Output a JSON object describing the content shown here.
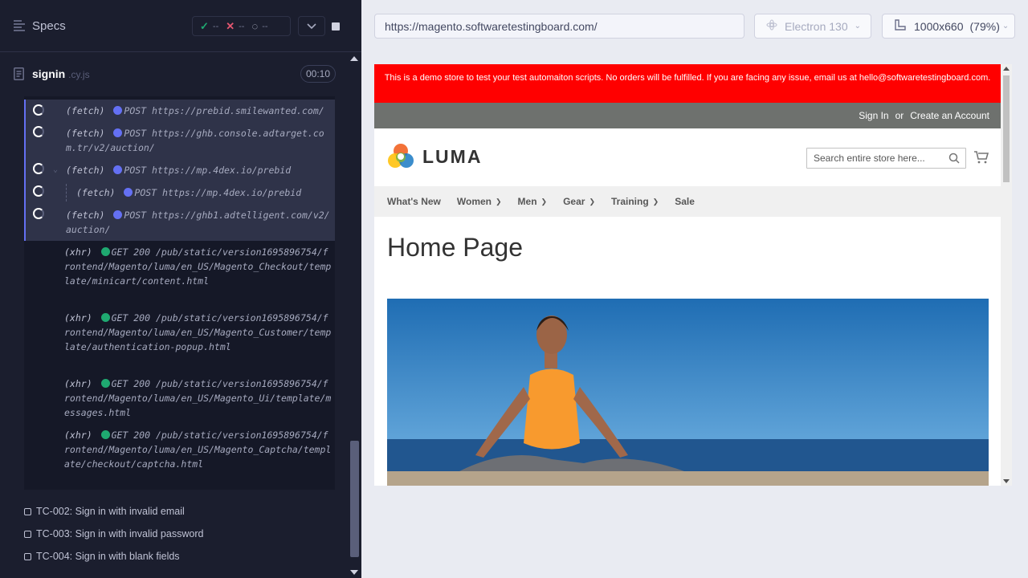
{
  "runner": {
    "header": {
      "title": "Specs"
    },
    "stats": {
      "passed": "--",
      "failed": "--",
      "pending": "--"
    },
    "spec": {
      "name": "signin",
      "ext": ".cy.js",
      "duration": "00:10"
    },
    "log": [
      {
        "kind": "(fetch)",
        "method": "POST",
        "url": "https://prebid.smilewanted.com/",
        "state": "pending",
        "dot": "fetch"
      },
      {
        "kind": "(fetch)",
        "method": "POST",
        "url": "https://ghb.console.adtarget.com.tr/v2/auction/",
        "state": "pending",
        "dot": "fetch"
      },
      {
        "kind": "(fetch)",
        "method": "POST",
        "url": "https://mp.4dex.io/prebid",
        "state": "pending",
        "dot": "fetch",
        "expanded": true
      },
      {
        "kind": "(fetch)",
        "method": "POST",
        "url": "https://mp.4dex.io/prebid",
        "state": "pending",
        "dot": "fetch",
        "nested": true
      },
      {
        "kind": "(fetch)",
        "method": "POST",
        "url": "https://ghb1.adtelligent.com/v2/auction/",
        "state": "pending",
        "dot": "fetch"
      },
      {
        "kind": "(xhr)",
        "method": "GET 200",
        "url": "/pub/static/version1695896754/frontend/Magento/luma/en_US/Magento_Checkout/template/minicart/content.html",
        "state": "done",
        "dot": "xhr"
      },
      {
        "kind": "(xhr)",
        "method": "GET 200",
        "url": "/pub/static/version1695896754/frontend/Magento/luma/en_US/Magento_Customer/template/authentication-popup.html",
        "state": "done",
        "dot": "xhr"
      },
      {
        "kind": "(xhr)",
        "method": "GET 200",
        "url": "/pub/static/version1695896754/frontend/Magento/luma/en_US/Magento_Ui/template/messages.html",
        "state": "done",
        "dot": "xhr"
      },
      {
        "kind": "(xhr)",
        "method": "GET 200",
        "url": "/pub/static/version1695896754/frontend/Magento/luma/en_US/Magento_Captcha/template/checkout/captcha.html",
        "state": "done",
        "dot": "xhr"
      }
    ],
    "tests": [
      "TC-002: Sign in with invalid email",
      "TC-003: Sign in with invalid password",
      "TC-004: Sign in with blank fields"
    ]
  },
  "aut_bar": {
    "url": "https://magento.softwaretestingboard.com/",
    "browser": "Electron 130",
    "viewport": "1000x660",
    "zoom": "(79%)"
  },
  "site": {
    "banner": "This is a demo store to test your test automaiton scripts. No orders will be fulfilled. If you are facing any issue, email us at hello@softwaretestingboard.com.",
    "sign_in": "Sign In",
    "or": "or",
    "create_account": "Create an Account",
    "logo": "LUMA",
    "search_placeholder": "Search entire store here...",
    "nav": [
      {
        "label": "What's New",
        "caret": false
      },
      {
        "label": "Women",
        "caret": true
      },
      {
        "label": "Men",
        "caret": true
      },
      {
        "label": "Gear",
        "caret": true
      },
      {
        "label": "Training",
        "caret": true
      },
      {
        "label": "Sale",
        "caret": false
      }
    ],
    "heading": "Home Page"
  },
  "colors": {
    "runner_bg": "#1b1e2e",
    "pending_accent": "#6470f3",
    "xhr_dot": "#1fa971",
    "banner_red": "#ff0000"
  }
}
